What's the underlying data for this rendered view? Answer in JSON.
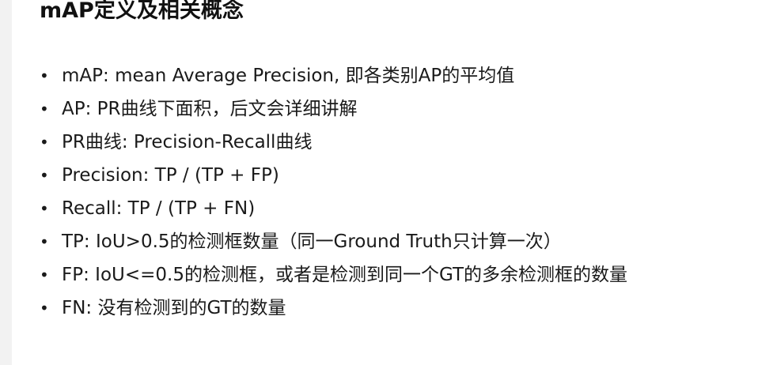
{
  "heading": "mAP定义及相关概念",
  "bullet_symbol": "•",
  "items": [
    {
      "text": "mAP: mean Average Precision, 即各类别AP的平均值"
    },
    {
      "text": "AP: PR曲线下面积，后文会详细讲解"
    },
    {
      "text": "PR曲线: Precision-Recall曲线"
    },
    {
      "text": "Precision: TP / (TP + FP)"
    },
    {
      "text": "Recall: TP / (TP + FN)"
    },
    {
      "text": "TP: IoU>0.5的检测框数量（同一Ground Truth只计算一次）"
    },
    {
      "text": "FP: IoU<=0.5的检测框，或者是检测到同一个GT的多余检测框的数量"
    },
    {
      "text": "FN: 没有检测到的GT的数量"
    }
  ]
}
